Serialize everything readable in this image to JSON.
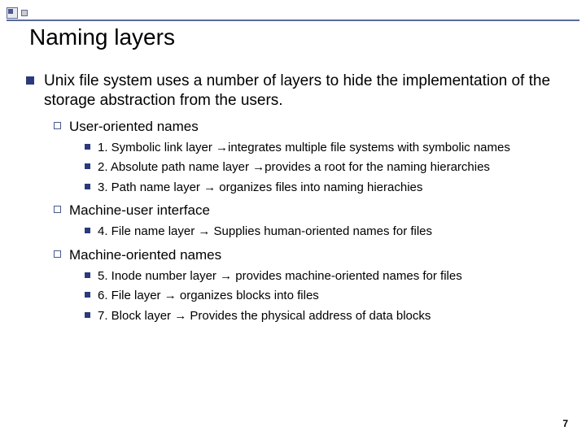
{
  "title": "Naming layers",
  "main_bullet": "Unix file system uses a number of layers to hide the implementation of the storage abstraction from the users.",
  "sections": [
    {
      "heading": "User-oriented names",
      "items": [
        "1. Symbolic link layer →integrates multiple file systems with symbolic names",
        "2. Absolute path name layer →provides a root for the naming hierarchies",
        "3. Path name layer → organizes files into naming hierachies"
      ]
    },
    {
      "heading": "Machine-user interface",
      "items": [
        "4. File name layer → Supplies human-oriented names for files"
      ]
    },
    {
      "heading": "Machine-oriented names",
      "items": [
        "5. Inode number layer → provides machine-oriented names for files",
        "6. File layer → organizes blocks into files",
        "7. Block layer → Provides the physical address of data blocks"
      ]
    }
  ],
  "page_number": "7"
}
